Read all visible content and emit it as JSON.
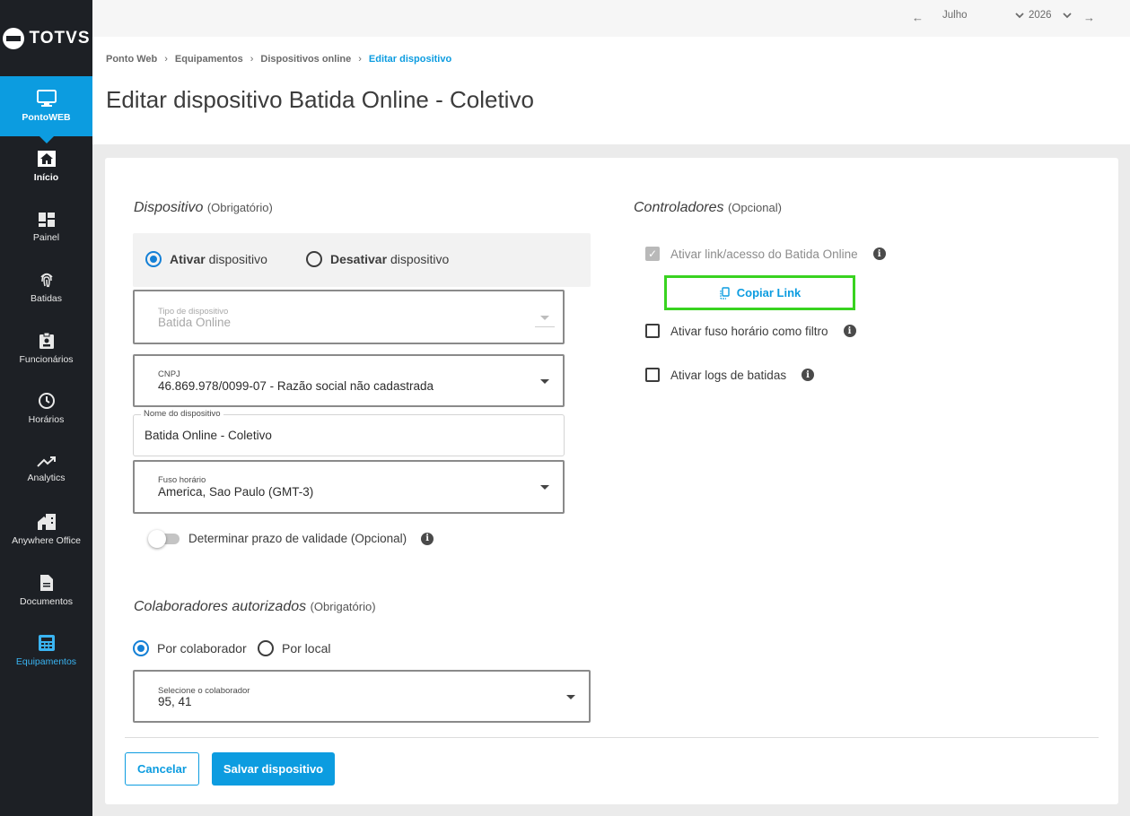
{
  "app": {
    "brand": "TOTVS"
  },
  "sidebar": {
    "top_item": {
      "label": "PontoWEB",
      "icon": "monitor-icon"
    },
    "items": [
      {
        "label": "Início",
        "icon": "home-icon"
      },
      {
        "label": "Painel",
        "icon": "dashboard-icon"
      },
      {
        "label": "Batidas",
        "icon": "fingerprint-icon"
      },
      {
        "label": "Funcionários",
        "icon": "badge-icon"
      },
      {
        "label": "Horários",
        "icon": "clock-icon"
      },
      {
        "label": "Analytics",
        "icon": "trending-up-icon"
      },
      {
        "label": "Anywhere Office",
        "icon": "home-work-icon"
      },
      {
        "label": "Documentos",
        "icon": "document-icon"
      },
      {
        "label": "Equipamentos",
        "icon": "devices-icon"
      }
    ],
    "colors": {
      "bg": "#1d2025",
      "active": "#0c9ce0",
      "current_text": "#3ab4f2"
    }
  },
  "topbar": {
    "month": "Julho",
    "year": "2026"
  },
  "breadcrumb": {
    "items": [
      "Ponto Web",
      "Equipamentos",
      "Dispositivos online"
    ],
    "current": "Editar dispositivo",
    "separator": "›"
  },
  "page": {
    "title": "Editar dispositivo Batida Online - Coletivo"
  },
  "device_section": {
    "title": "Dispositivo",
    "optional": "(Obrigatório)",
    "activate": {
      "bold": "Ativar",
      "rest": "dispositivo",
      "selected": true
    },
    "deactivate": {
      "bold": "Desativar",
      "rest": "dispositivo",
      "selected": false
    },
    "type_field": {
      "label": "Tipo de dispositivo",
      "value": "Batida Online"
    },
    "cnpj_field": {
      "label": "CNPJ",
      "value": "46.869.978/0099-07 - Razão social não cadastrada"
    },
    "name_field": {
      "label": "Nome do dispositivo",
      "value": "Batida Online - Coletivo"
    },
    "timezone_field": {
      "label": "Fuso horário",
      "value": "America, Sao Paulo (GMT-3)"
    },
    "validity_toggle": {
      "label": "Determinar prazo de validade (Opcional)",
      "on": false
    }
  },
  "collaborators_section": {
    "title": "Colaboradores autorizados",
    "optional": "(Obrigatório)",
    "by_collaborator": {
      "label": "Por colaborador",
      "selected": true
    },
    "by_location": {
      "label": "Por local",
      "selected": false
    },
    "select_field": {
      "label": "Selecione o colaborador",
      "value": "95, 41"
    }
  },
  "controllers_section": {
    "title": "Controladores",
    "optional": "(Opcional)",
    "online_link": {
      "label": "Ativar link/acesso do Batida Online",
      "checked": true,
      "disabled": true
    },
    "copy_link": {
      "label": "Copiar Link",
      "icon": "copy-icon"
    },
    "timezone_filter": {
      "label": "Ativar fuso horário como filtro",
      "checked": false
    },
    "logs": {
      "label": "Ativar logs de batidas",
      "checked": false
    }
  },
  "actions": {
    "cancel": "Cancelar",
    "save": "Salvar dispositivo"
  },
  "info_symbol": "i",
  "check_symbol": "✓"
}
